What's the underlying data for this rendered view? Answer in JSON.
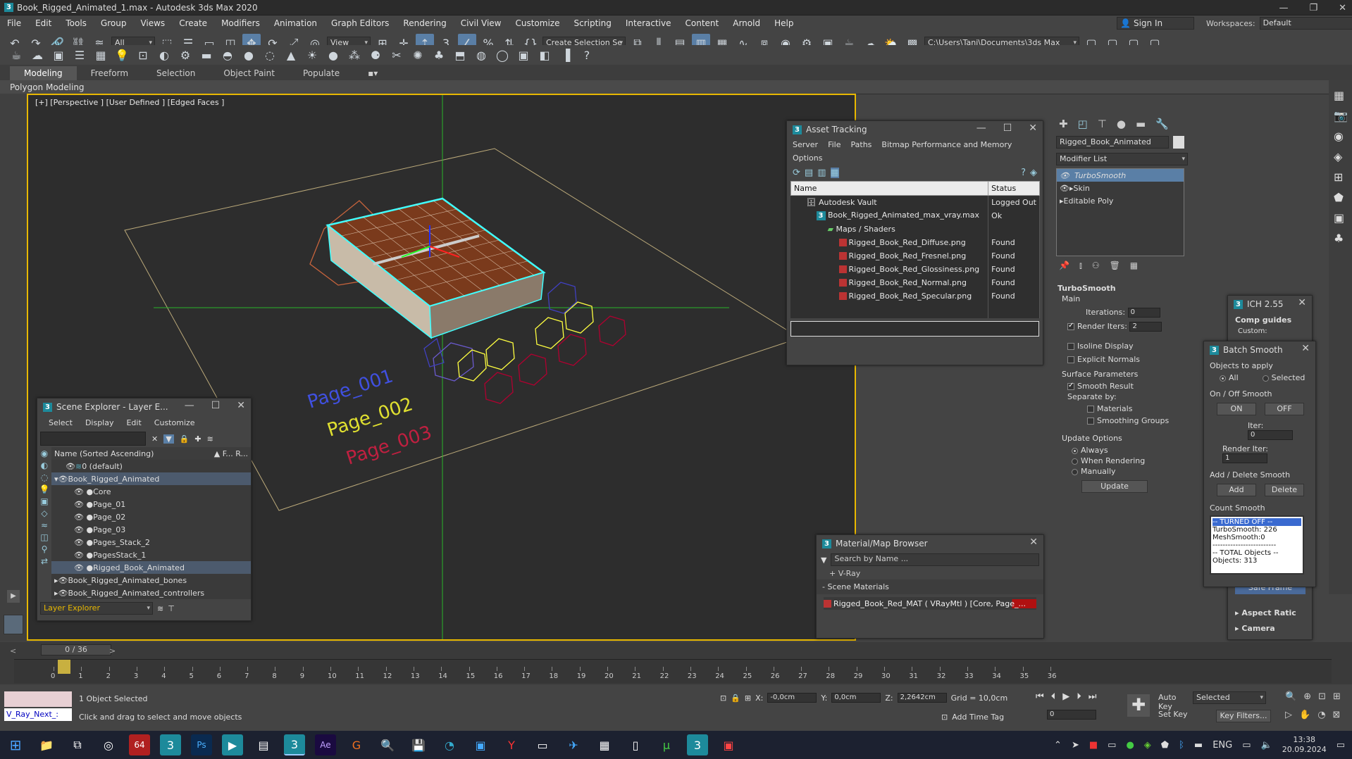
{
  "window": {
    "title": "Book_Rigged_Animated_1.max - Autodesk 3ds Max 2020",
    "controls": [
      "—",
      "❐",
      "✕"
    ]
  },
  "menu": [
    "File",
    "Edit",
    "Tools",
    "Group",
    "Views",
    "Create",
    "Modifiers",
    "Animation",
    "Graph Editors",
    "Rendering",
    "Civil View",
    "Customize",
    "Scripting",
    "Interactive",
    "Content",
    "Arnold",
    "Help"
  ],
  "account": {
    "signin": "Sign In",
    "workspaces_label": "Workspaces:",
    "workspace": "Default"
  },
  "toolbar": {
    "filter": "All",
    "refcoord": "View",
    "selection_set": "Create Selection Se",
    "path": "C:\\Users\\Tani\\Documents\\3ds Max 2020"
  },
  "ribbon": {
    "tabs": [
      "Modeling",
      "Freeform",
      "Selection",
      "Object Paint",
      "Populate"
    ],
    "sub": "Polygon Modeling"
  },
  "viewport": {
    "label": "[+] [Perspective ] [User Defined ] [Edged Faces ]",
    "texts": [
      "Page_001",
      "Page_002",
      "Page_003"
    ]
  },
  "asset_tracking": {
    "title": "Asset Tracking",
    "menu": [
      "Server",
      "File",
      "Paths",
      "Bitmap Performance and Memory"
    ],
    "menu2": "Options",
    "columns": [
      "Name",
      "Status"
    ],
    "rows": [
      {
        "name": "Autodesk Vault",
        "status": "Logged Out"
      },
      {
        "name": "Book_Rigged_Animated_max_vray.max",
        "status": "Ok"
      },
      {
        "name": "Maps / Shaders",
        "status": ""
      },
      {
        "name": "Rigged_Book_Red_Diffuse.png",
        "status": "Found"
      },
      {
        "name": "Rigged_Book_Red_Fresnel.png",
        "status": "Found"
      },
      {
        "name": "Rigged_Book_Red_Glossiness.png",
        "status": "Found"
      },
      {
        "name": "Rigged_Book_Red_Normal.png",
        "status": "Found"
      },
      {
        "name": "Rigged_Book_Red_Specular.png",
        "status": "Found"
      }
    ]
  },
  "scene_explorer": {
    "title": "Scene Explorer - Layer E...",
    "menu": [
      "Select",
      "Display",
      "Edit",
      "Customize"
    ],
    "col_name": "Name (Sorted Ascending)",
    "col_f": "▲ F...",
    "col_r": "R...",
    "rows": [
      "0 (default)",
      "Book_Rigged_Animated",
      "Core",
      "Page_01",
      "Page_02",
      "Page_03",
      "Pages_Stack_2",
      "PagesStack_1",
      "Rigged_Book_Animated",
      "Book_Rigged_Animated_bones",
      "Book_Rigged_Animated_controllers"
    ],
    "footer": "Layer Explorer"
  },
  "material_browser": {
    "title": "Material/Map Browser",
    "search": "Search by Name ...",
    "vray": "+ V-Ray",
    "section": "- Scene Materials",
    "item": "Rigged_Book_Red_MAT ( VRayMtl ) [Core, Page_..."
  },
  "command_panel": {
    "object_name": "Rigged_Book_Animated",
    "modifier_list": "Modifier List",
    "stack": [
      "TurboSmooth",
      "Skin",
      "Editable Poly"
    ],
    "rollout": "TurboSmooth",
    "main": "Main",
    "iterations_label": "Iterations:",
    "iterations": "0",
    "render_iters_label": "Render Iters:",
    "render_iters": "2",
    "isoline": "Isoline Display",
    "explicit": "Explicit Normals",
    "surface": "Surface Parameters",
    "smooth_result": "Smooth Result",
    "separate": "Separate by:",
    "materials": "Materials",
    "smoothing_groups": "Smoothing Groups",
    "update_options": "Update Options",
    "always": "Always",
    "when_rendering": "When Rendering",
    "manually": "Manually",
    "update": "Update"
  },
  "ich": {
    "title": "ICH 2.55",
    "comp": "Comp guides",
    "custom": "Custom:",
    "safe": "Safe Frame",
    "aspect": "Aspect Ratic",
    "camera": "Camera"
  },
  "batch_smooth": {
    "title": "Batch Smooth",
    "objects_to_apply": "Objects to apply",
    "all": "All",
    "selected": "Selected",
    "onoff": "On / Off Smooth",
    "on": "ON",
    "off": "OFF",
    "iter_label": "Iter:",
    "iter": "0",
    "render_iter_label": "Render Iter:",
    "render_iter": "1",
    "add_delete": "Add / Delete Smooth",
    "add": "Add",
    "delete": "Delete",
    "count": "Count Smooth",
    "lines": [
      "-- TURNED OFF --",
      "TurboSmooth: 226",
      "MeshSmooth:0",
      "-------------------------",
      "-- TOTAL Objects --",
      "Objects: 313"
    ]
  },
  "timeline": {
    "frame": "0 / 36",
    "ticks": [
      "0",
      "1",
      "2",
      "3",
      "4",
      "5",
      "6",
      "7",
      "8",
      "9",
      "10",
      "11",
      "12",
      "13",
      "14",
      "15",
      "16",
      "17",
      "18",
      "19",
      "20",
      "21",
      "22",
      "23",
      "24",
      "25",
      "26",
      "27",
      "28",
      "29",
      "30",
      "31",
      "32",
      "33",
      "34",
      "35",
      "36"
    ]
  },
  "status": {
    "selected": "1 Object Selected",
    "hint": "Click and drag to select and move objects",
    "script": "V_Ray_Next_:",
    "x_label": "X:",
    "x": "-0,0cm",
    "y_label": "Y:",
    "y": "0,0cm",
    "z_label": "Z:",
    "z": "2,2642cm",
    "grid": "Grid = 10,0cm",
    "add_time_tag": "Add Time Tag",
    "auto_key": "Auto Key",
    "set_key": "Set Key",
    "key_mode": "Selected",
    "key_filters": "Key Filters...",
    "frame_field": "0"
  },
  "taskbar": {
    "lang": "ENG",
    "time": "13:38",
    "date": "20.09.2024"
  },
  "colors": {
    "selection": "#5a7fa6",
    "accent": "#e8b800"
  }
}
